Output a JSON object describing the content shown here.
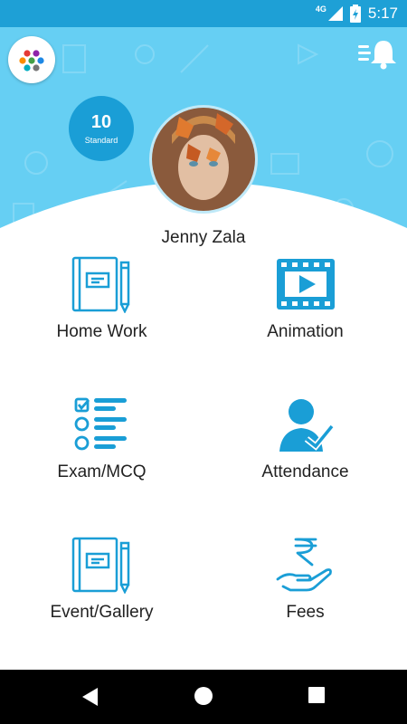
{
  "status_bar": {
    "network": "4G",
    "time": "5:17",
    "battery_icon": "battery-charging-icon",
    "signal_icon": "cell-signal-icon"
  },
  "header": {
    "logo_icon": "app-logo-dots-icon",
    "notification_icon": "notification-bell-icon",
    "standard_number": "10",
    "standard_label": "Standard",
    "user_name": "Jenny Zala"
  },
  "menu": [
    {
      "label": "Home Work",
      "icon": "notebook-pencil-icon"
    },
    {
      "label": "Animation",
      "icon": "video-film-icon"
    },
    {
      "label": "Exam/MCQ",
      "icon": "checklist-icon"
    },
    {
      "label": "Attendance",
      "icon": "person-check-icon"
    },
    {
      "label": "Event/Gallery",
      "icon": "notebook-pencil-icon"
    },
    {
      "label": "Fees",
      "icon": "rupee-hand-icon"
    }
  ],
  "nav": {
    "back_icon": "back-triangle-icon",
    "home_icon": "home-circle-icon",
    "recents_icon": "recents-square-icon"
  },
  "colors": {
    "status_bar": "#1ea0d6",
    "header": "#66cff3",
    "accent": "#1a9ed6",
    "icon": "#1a9ed6"
  }
}
